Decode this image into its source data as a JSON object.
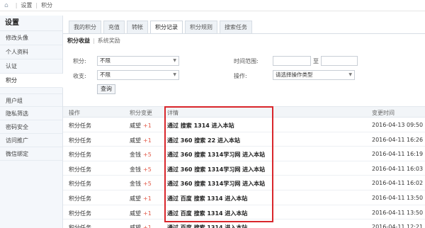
{
  "breadcrumb": {
    "home_icon": "home-icon",
    "items": [
      "设置",
      "积分"
    ]
  },
  "sidebar": {
    "title": "设置",
    "items": [
      "修改头像",
      "个人资料",
      "认证",
      "积分",
      "用户组",
      "隐私筛选",
      "密码安全",
      "访问推广",
      "微信绑定"
    ],
    "active": "积分"
  },
  "tabs": [
    "我的积分",
    "充值",
    "转帐",
    "积分记录",
    "积分规则",
    "搜索任务"
  ],
  "active_tab": "积分记录",
  "subtabs": [
    "积分收益",
    "系统奖励"
  ],
  "filters": {
    "credit_label": "积分:",
    "credit_value": "不限",
    "income_label": "收支:",
    "income_value": "不限",
    "time_label": "时间范围:",
    "time_sep": "至",
    "op_label": "操作:",
    "op_value": "请选择操作类型",
    "query_button": "查询"
  },
  "table": {
    "headers": [
      "操作",
      "积分变更",
      "详情",
      "变更时间"
    ],
    "rows": [
      {
        "op": "积分任务",
        "type": "威望",
        "delta": "+1",
        "detail": "通过 搜索 1314 进入本站",
        "time": "2016-04-13 09:50"
      },
      {
        "op": "积分任务",
        "type": "威望",
        "delta": "+1",
        "detail": "通过 360 搜索 22 进入本站",
        "time": "2016-04-11 16:26"
      },
      {
        "op": "积分任务",
        "type": "金钱",
        "delta": "+5",
        "detail": "通过 360 搜索 1314学习网 进入本站",
        "time": "2016-04-11 16:19"
      },
      {
        "op": "积分任务",
        "type": "金钱",
        "delta": "+5",
        "detail": "通过 360 搜索 1314学习网 进入本站",
        "time": "2016-04-11 16:03"
      },
      {
        "op": "积分任务",
        "type": "金钱",
        "delta": "+5",
        "detail": "通过 360 搜索 1314学习网 进入本站",
        "time": "2016-04-11 16:02"
      },
      {
        "op": "积分任务",
        "type": "威望",
        "delta": "+1",
        "detail": "通过 百度 搜索 1314 进入本站",
        "time": "2016-04-11 13:50"
      },
      {
        "op": "积分任务",
        "type": "威望",
        "delta": "+1",
        "detail": "通过 百度 搜索 1314 进入本站",
        "time": "2016-04-11 13:50"
      },
      {
        "op": "积分任务",
        "type": "威望",
        "delta": "+1",
        "detail": "通过 百度 搜索 1314 进入本站",
        "time": "2016-04-11 12:21"
      }
    ]
  },
  "colors": {
    "highlight": "#d9262b",
    "plus": "#e25b4a"
  }
}
